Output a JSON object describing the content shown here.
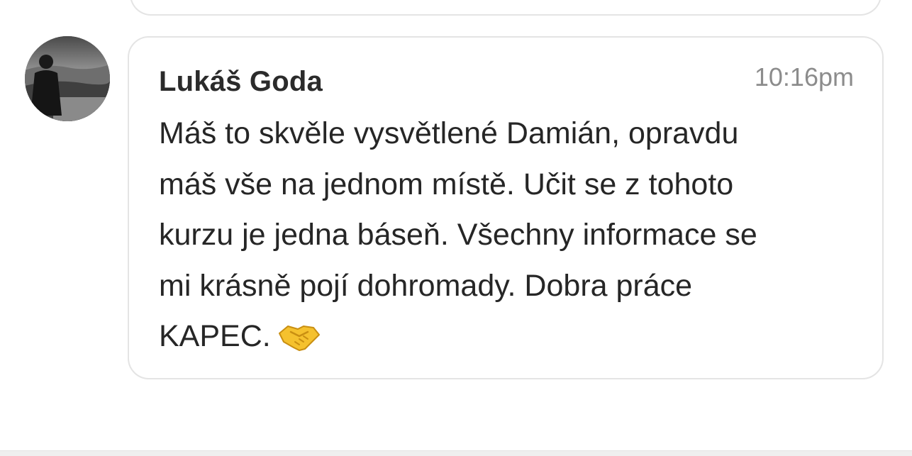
{
  "comment": {
    "author": "Lukáš Goda",
    "time": "10:16pm",
    "text": "Máš to skvěle vysvětlené Damián, opravdu\nmáš vše na jednom místě. Učit se z tohoto\nkurzu je jedna báseň. Všechny informace se\nmi krásně pojí dohromady. Dobra práce\nKAPEC.",
    "emoji": "handshake-icon",
    "avatar": "avatar-photo"
  },
  "colors": {
    "card_border": "#e4e4e4",
    "text": "#262626",
    "time": "#8c8c8c",
    "emoji": "#f5c12e"
  }
}
